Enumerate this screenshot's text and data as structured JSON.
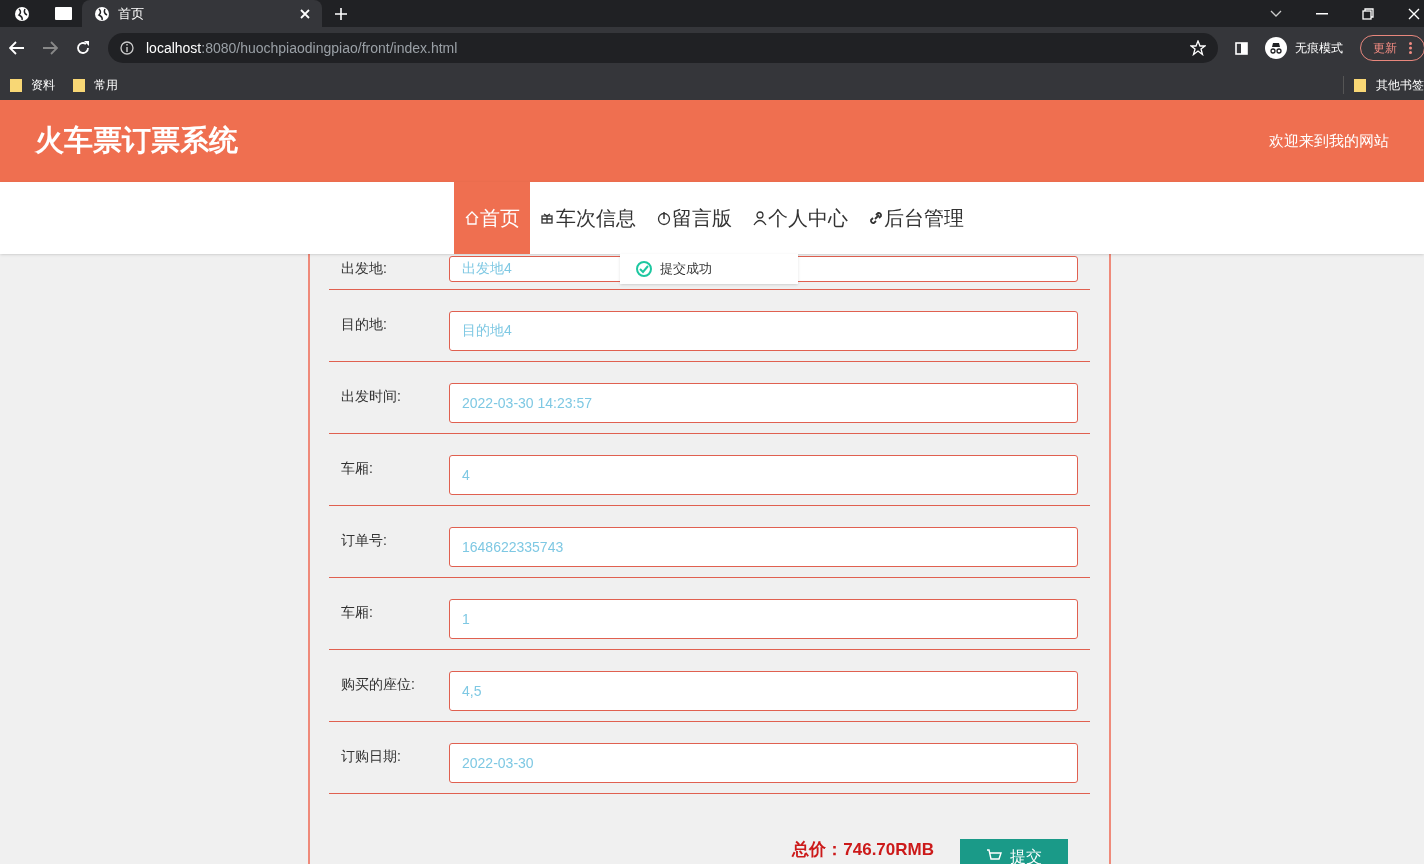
{
  "browser": {
    "tabs": [
      {
        "title": "首页",
        "selected": true
      }
    ],
    "url_host": "localhost",
    "url_rest": ":8080/huochpiaodingpiao/front/index.html",
    "profile": "无痕模式",
    "update": "更新",
    "bookmarks": [
      "资料",
      "常用"
    ],
    "other_bookmarks": "其他书签"
  },
  "header": {
    "title": "火车票订票系统",
    "welcome": "欢迎来到我的网站"
  },
  "nav": [
    {
      "label": "首页",
      "selected": true
    },
    {
      "label": "车次信息",
      "selected": false
    },
    {
      "label": "留言版",
      "selected": false
    },
    {
      "label": "个人中心",
      "selected": false
    },
    {
      "label": "后台管理",
      "selected": false
    }
  ],
  "toast": {
    "text": "提交成功"
  },
  "form": {
    "fields": [
      {
        "label": "出发地:",
        "value": "出发地4"
      },
      {
        "label": "目的地:",
        "value": "目的地4"
      },
      {
        "label": "出发时间:",
        "value": "2022-03-30 14:23:57"
      },
      {
        "label": "车厢:",
        "value": "4"
      },
      {
        "label": "订单号:",
        "value": "1648622335743"
      },
      {
        "label": "车厢:",
        "value": "1"
      },
      {
        "label": "购买的座位:",
        "value": "4,5"
      },
      {
        "label": "订购日期:",
        "value": "2022-03-30"
      }
    ],
    "total": "总价：746.70RMB",
    "submit": "提交"
  }
}
